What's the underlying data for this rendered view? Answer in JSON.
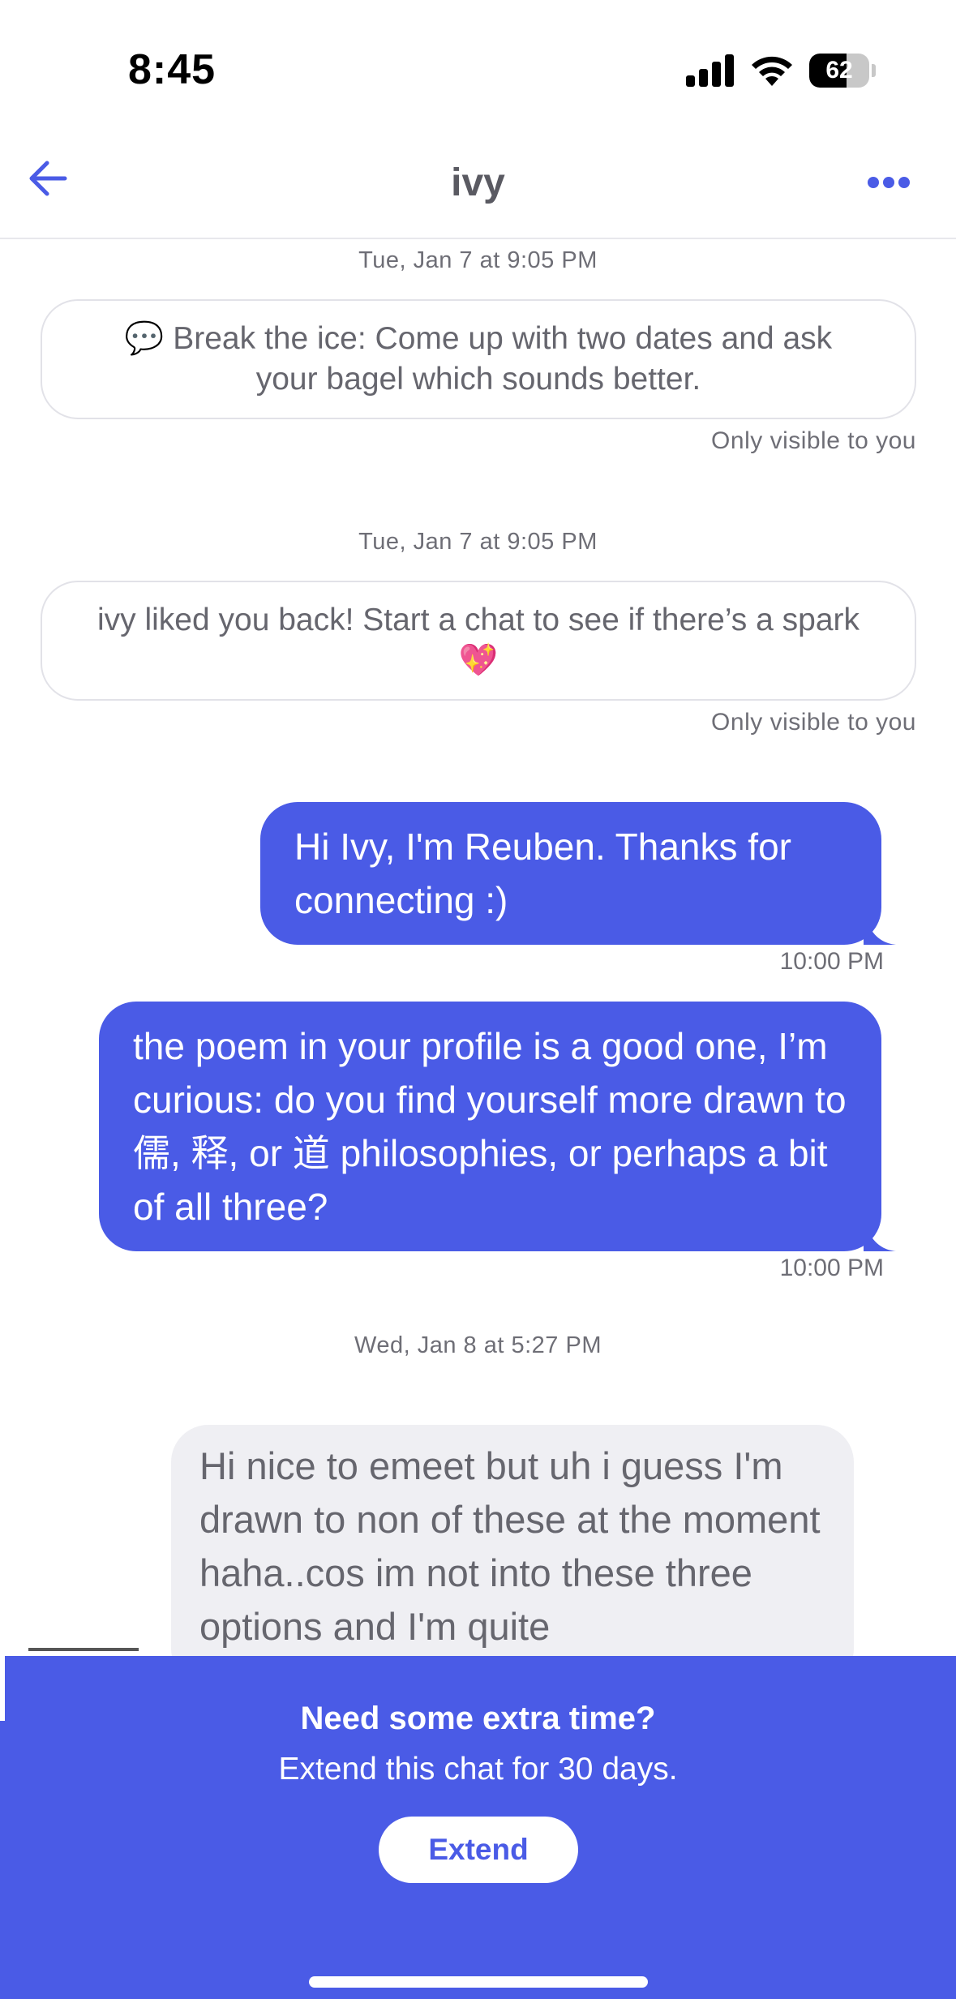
{
  "status_bar": {
    "time": "8:45",
    "battery": "62",
    "battery_level": 0.62
  },
  "nav": {
    "title": "ivy",
    "back_icon": "arrow-left-icon",
    "more_icon": "ellipsis-icon"
  },
  "chat": {
    "system_1": {
      "timestamp": "Tue, Jan 7 at 9:05 PM",
      "icon": "💬",
      "text": "Break the ice: Come up with two dates and ask your bagel which sounds better.",
      "note": "Only visible to you"
    },
    "system_2": {
      "timestamp": "Tue, Jan 7 at 9:05 PM",
      "text": "ivy liked you back! Start a chat to see if there’s a spark 💖",
      "note": "Only visible to you"
    },
    "sent_1": {
      "text": "Hi Ivy, I'm Reuben. Thanks for connecting :)",
      "time": "10:00 PM"
    },
    "sent_2": {
      "text": "the poem in your profile is a good one, I’m curious: do you find yourself more drawn to 儒, 释, or 道 philosophies, or perhaps a bit of all three?",
      "time": "10:00 PM"
    },
    "day_separator": "Wed, Jan 8 at 5:27 PM",
    "received_1": {
      "text": "Hi nice to emeet but uh i guess I'm drawn to non of these at the moment haha..cos im not into these three options and I'm quite"
    }
  },
  "extend_banner": {
    "title": "Need some extra time?",
    "subtitle": "Extend this chat for 30 days.",
    "button_label": "Extend"
  },
  "colors": {
    "accent": "#4a5be6",
    "received_bubble": "#efeff3",
    "muted_text": "#6e6e76"
  }
}
